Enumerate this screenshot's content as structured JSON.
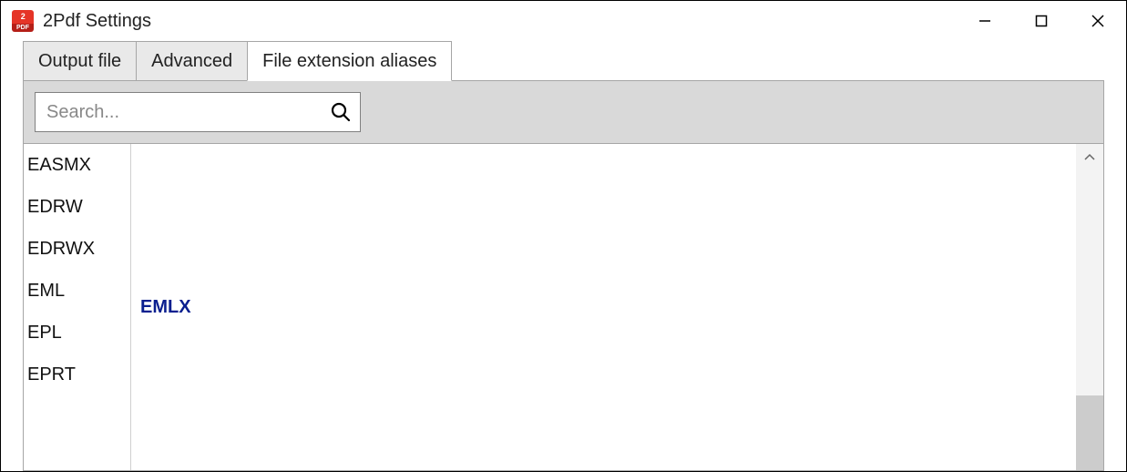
{
  "window": {
    "title": "2Pdf Settings",
    "icon_top": "2",
    "icon_bottom": "PDF"
  },
  "tabs": [
    {
      "label": "Output file",
      "active": false
    },
    {
      "label": "Advanced",
      "active": false
    },
    {
      "label": "File extension aliases",
      "active": true
    }
  ],
  "search": {
    "placeholder": "Search...",
    "value": ""
  },
  "extensions": [
    {
      "name": "EASMX",
      "alias": ""
    },
    {
      "name": "EDRW",
      "alias": ""
    },
    {
      "name": "EDRWX",
      "alias": ""
    },
    {
      "name": "EML",
      "alias": "EMLX"
    },
    {
      "name": "EPL",
      "alias": ""
    },
    {
      "name": "EPRT",
      "alias": ""
    }
  ],
  "scrollbar": {
    "thumb_top_pct": 75,
    "thumb_height_pct": 25
  }
}
